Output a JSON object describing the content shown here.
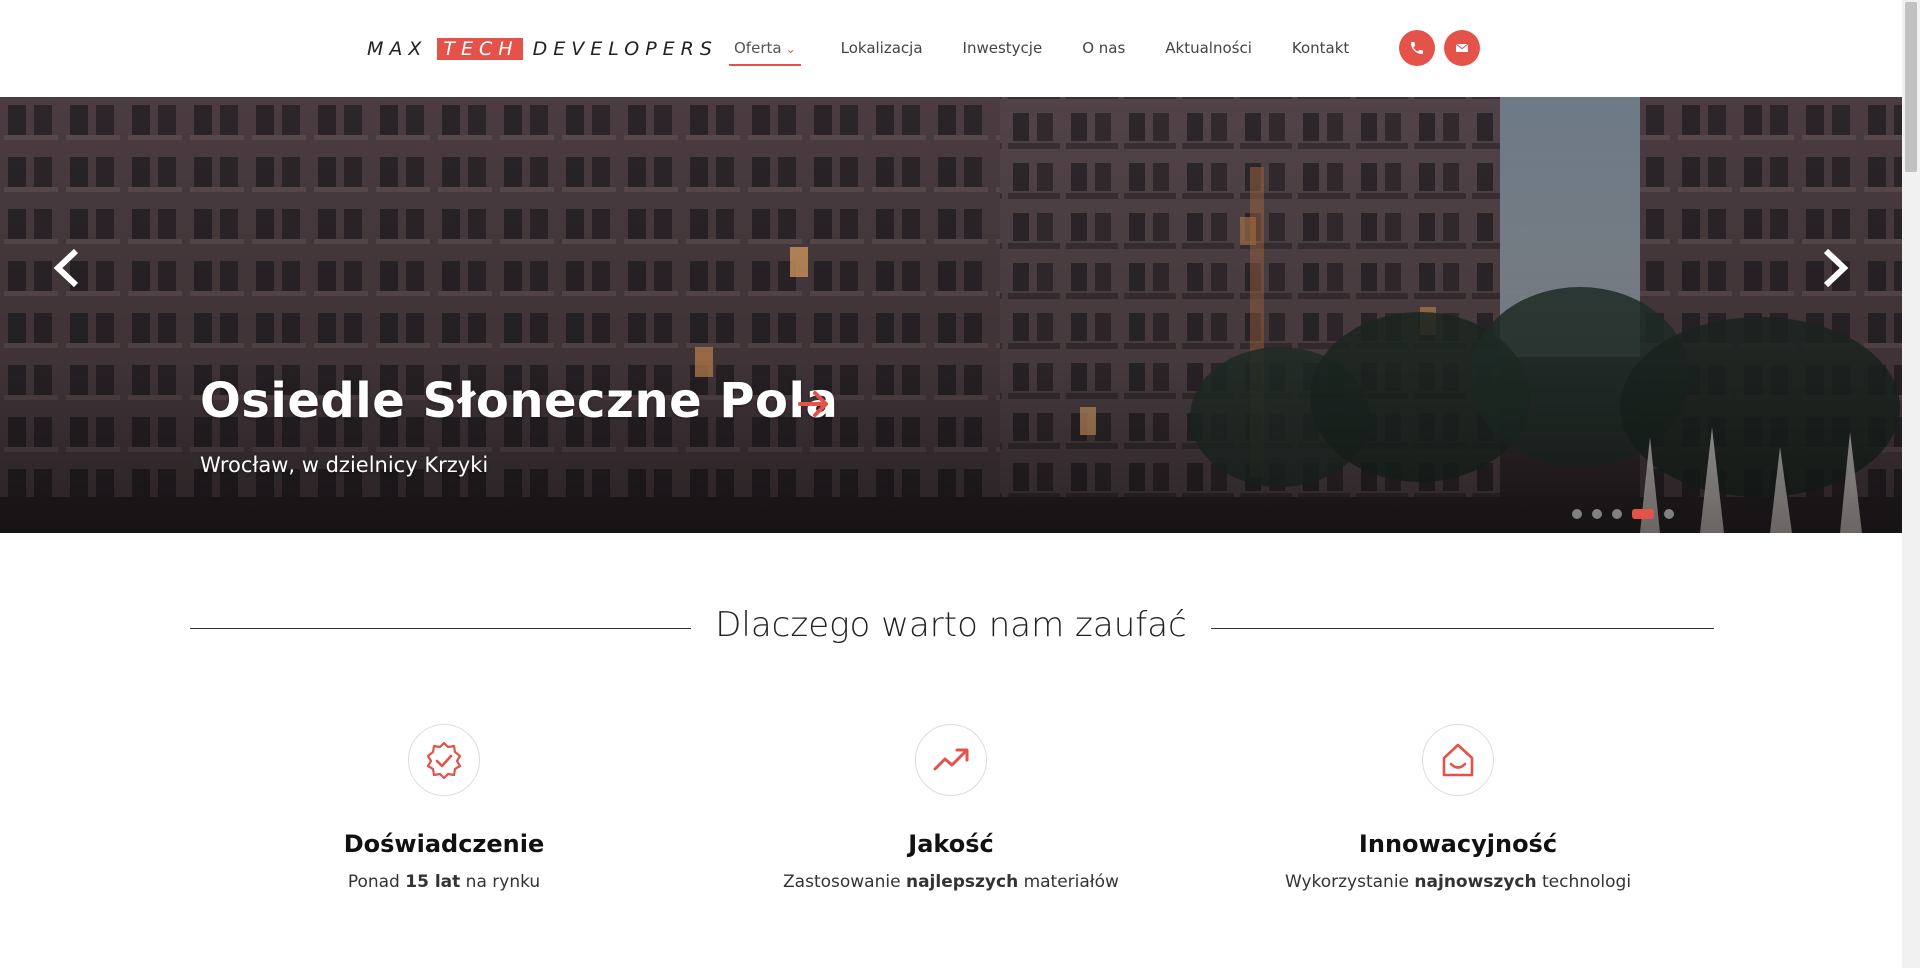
{
  "brand": {
    "name_before": "MAX",
    "name_highlight": "TECH",
    "name_after": "DEVELOPERS",
    "accent_color": "#e4534a"
  },
  "nav": {
    "items": [
      {
        "label": "Oferta",
        "active": true,
        "has_dropdown": true
      },
      {
        "label": "Lokalizacja"
      },
      {
        "label": "Inwestycje"
      },
      {
        "label": "O nas"
      },
      {
        "label": "Aktualności"
      },
      {
        "label": "Kontakt"
      }
    ],
    "phone_icon": "phone-icon",
    "email_icon": "envelope-icon"
  },
  "hero": {
    "title": "Osiedle Słoneczne Pola",
    "subtitle": "Wrocław, w dzielnicy Krzyki",
    "prev_icon": "chevron-left-icon",
    "next_icon": "chevron-right-icon",
    "slide_count": 5,
    "active_slide": 4
  },
  "section": {
    "title": "Dlaczego warto nam zaufać"
  },
  "features": [
    {
      "icon": "badge-check-icon",
      "title": "Doświadczenie",
      "desc_before": "Ponad ",
      "desc_bold": "15 lat",
      "desc_after": " na rynku"
    },
    {
      "icon": "trending-up-icon",
      "title": "Jakość",
      "desc_before": "Zastosowanie ",
      "desc_bold": "najlepszych",
      "desc_after": " materiałów"
    },
    {
      "icon": "home-smile-icon",
      "title": "Innowacyjność",
      "desc_before": "Wykorzystanie ",
      "desc_bold": "najnowszych",
      "desc_after": " technologi"
    }
  ]
}
